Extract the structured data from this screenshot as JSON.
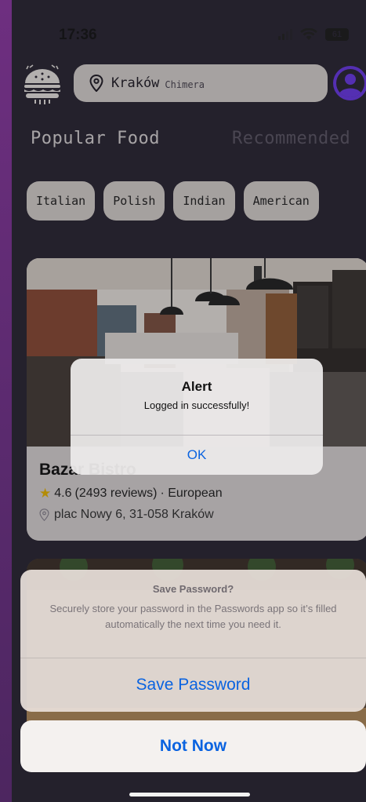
{
  "status_bar": {
    "time": "17:36",
    "battery": "61"
  },
  "header": {
    "city": "Kraków",
    "subtitle": "Chimera"
  },
  "tabs": [
    {
      "label": "Popular Food"
    },
    {
      "label": "Recommended"
    }
  ],
  "categories": [
    {
      "label": "Italian"
    },
    {
      "label": "Polish"
    },
    {
      "label": "Indian"
    },
    {
      "label": "American"
    }
  ],
  "restaurant": {
    "name": "Bazar Bistro",
    "rating": "4.6",
    "reviews": "(2493 reviews)",
    "cuisine": "· European",
    "address": "plac Nowy 6, 31-058 Kraków"
  },
  "alert": {
    "title": "Alert",
    "message": "Logged in successfully!",
    "ok_label": "OK"
  },
  "save_sheet": {
    "title": "Save Password?",
    "message": "Securely store your password in the Passwords app so it’s filled automatically the next time you need it.",
    "save_label": "Save Password",
    "cancel_label": "Not Now"
  },
  "colors": {
    "accent": "#0a63e0",
    "brand_purple": "#6a39e6",
    "star": "#e8b400"
  }
}
